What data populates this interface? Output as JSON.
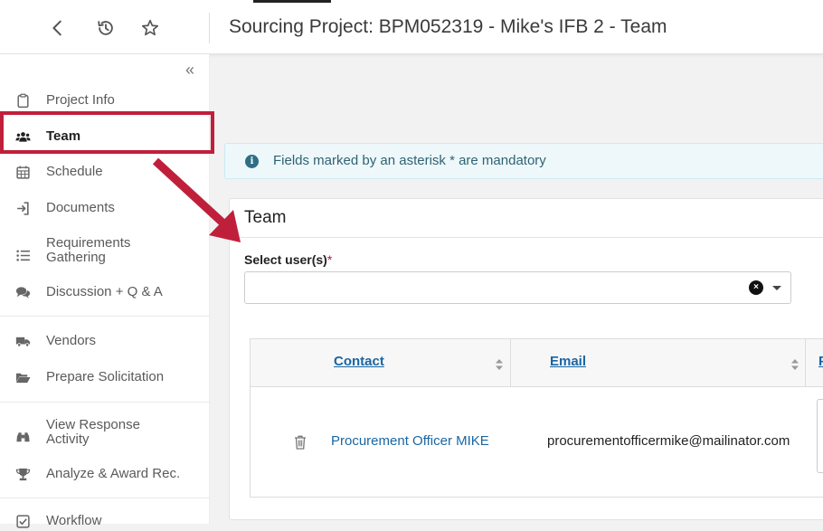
{
  "header": {
    "title": "Sourcing Project: BPM052319 - Mike's IFB 2 - Team",
    "back_icon": "chevron-left-icon",
    "history_icon": "history-icon",
    "favorite_icon": "star-outline-icon"
  },
  "sidebar": {
    "collapse_glyph": "«",
    "items": [
      {
        "label": "Project Info",
        "icon": "clipboard-icon"
      },
      {
        "label": "Team",
        "icon": "users-icon",
        "active": true
      },
      {
        "label": "Schedule",
        "icon": "calendar-icon"
      },
      {
        "label": "Documents",
        "icon": "sign-in-icon"
      },
      {
        "label": "Requirements Gathering",
        "line1": "Requirements",
        "line2": "Gathering",
        "icon": "list-icon"
      },
      {
        "label": "Discussion + Q & A",
        "icon": "comments-icon"
      },
      {
        "label": "Vendors",
        "icon": "truck-icon"
      },
      {
        "label": "Prepare Solicitation",
        "icon": "folder-open-icon"
      },
      {
        "label": "View Response Activity",
        "line1": "View Response",
        "line2": "Activity",
        "icon": "binoculars-icon"
      },
      {
        "label": "Analyze & Award Rec.",
        "icon": "trophy-icon"
      },
      {
        "label": "Workflow",
        "icon": "check-square-icon"
      }
    ]
  },
  "banner": {
    "text": "Fields marked by an asterisk * are mandatory",
    "icon_glyph": "i"
  },
  "team_card": {
    "title": "Team",
    "select_label": "Select user(s)",
    "required_mark": "*",
    "clear_glyph": "×",
    "table": {
      "columns": [
        "Contact",
        "Email",
        "P"
      ],
      "rows": [
        {
          "contact": "Procurement Officer MIKE",
          "email": "procurementofficermike@mailinator.com"
        }
      ]
    }
  },
  "colors": {
    "callout": "#c01f3b",
    "link": "#1a66a3",
    "banner_bg": "#eef8fb",
    "banner_text": "#2f6273"
  }
}
